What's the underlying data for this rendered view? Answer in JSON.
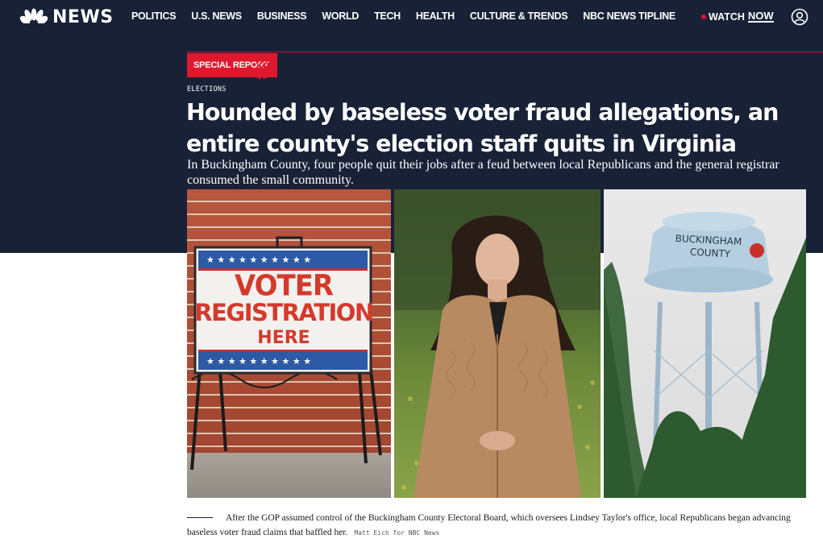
{
  "brand": {
    "logo_text": "NEWS",
    "logo_icon": "nbc-peacock-icon"
  },
  "nav": {
    "items": [
      {
        "label": "POLITICS"
      },
      {
        "label": "U.S. NEWS"
      },
      {
        "label": "BUSINESS"
      },
      {
        "label": "WORLD"
      },
      {
        "label": "TECH"
      },
      {
        "label": "HEALTH"
      },
      {
        "label": "CULTURE & TRENDS"
      },
      {
        "label": "NBC NEWS TIPLINE"
      }
    ],
    "watch_label": "WATCH",
    "watch_now_label": "NOW",
    "account_icon": "account-icon"
  },
  "article": {
    "badge": "SPECIAL REPORT",
    "category": "ELECTIONS",
    "headline": "Hounded by baseless voter fraud allegations, an entire county's election staff quits in Virginia",
    "dek": "In Buckingham County, four people quit their jobs after a feud between local Republicans and the general registrar consumed the small community."
  },
  "images": {
    "sign": {
      "line1": "VOTER",
      "line2": "REGISTRATION",
      "line3": "HERE"
    },
    "tower": {
      "line1": "BUCKINGHAM",
      "line2": "COUNTY"
    }
  },
  "caption": {
    "text": "After the GOP assumed control of the Buckingham County Electoral Board, which oversees Lindsey Taylor's office, local Republicans began advancing baseless voter fraud claims that baffled her.",
    "credit": "Matt Eich for NBC News"
  },
  "colors": {
    "navy": "#182136",
    "red": "#e0182d",
    "white": "#ffffff"
  }
}
